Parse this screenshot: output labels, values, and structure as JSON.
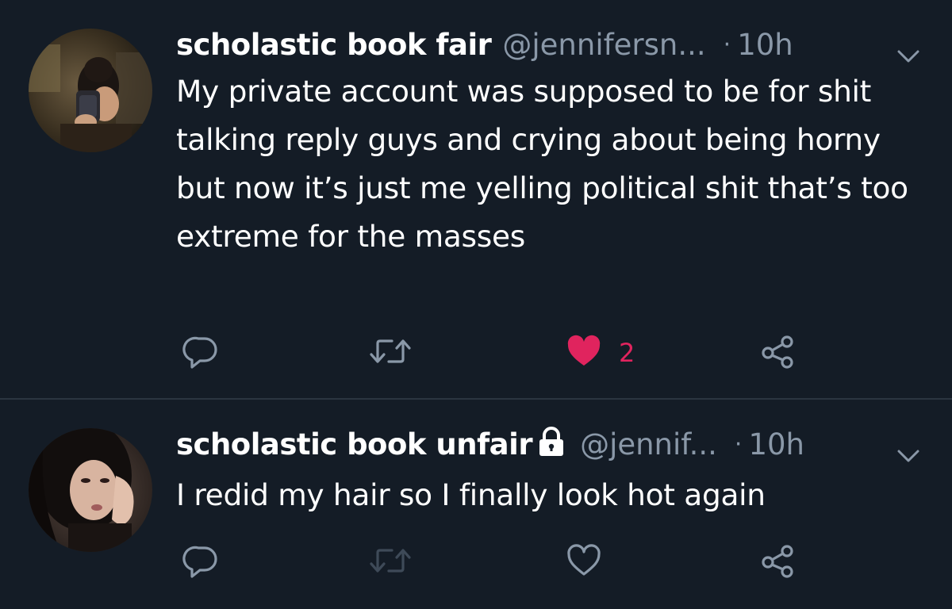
{
  "colors": {
    "background": "#141c26",
    "text_primary": "#ffffff",
    "text_secondary": "#8a98a8",
    "like_active": "#e0245e",
    "divider": "#2b3540"
  },
  "tweets": [
    {
      "display_name": "scholastic book fair",
      "protected": false,
      "handle": "@jennifersn...",
      "dot": "·",
      "time": "10h",
      "text": "My private account was supposed to be for shit talking reply guys and crying about being horny but now it’s just me yelling political shit that’s too extreme for the masses",
      "like_count": "2",
      "liked": true,
      "icons": {
        "reply": "reply-icon",
        "retweet": "retweet-icon",
        "like": "heart-filled-icon",
        "share": "share-icon",
        "menu": "chevron-down-icon"
      }
    },
    {
      "display_name": "scholastic book unfair",
      "protected": true,
      "handle": "@jennif...",
      "dot": "·",
      "time": "10h",
      "text": "I redid my hair so I finally look hot again",
      "like_count": "",
      "liked": false,
      "icons": {
        "lock": "lock-icon",
        "reply": "reply-icon",
        "retweet": "retweet-icon",
        "like": "heart-outline-icon",
        "share": "share-icon",
        "menu": "chevron-down-icon"
      }
    }
  ]
}
